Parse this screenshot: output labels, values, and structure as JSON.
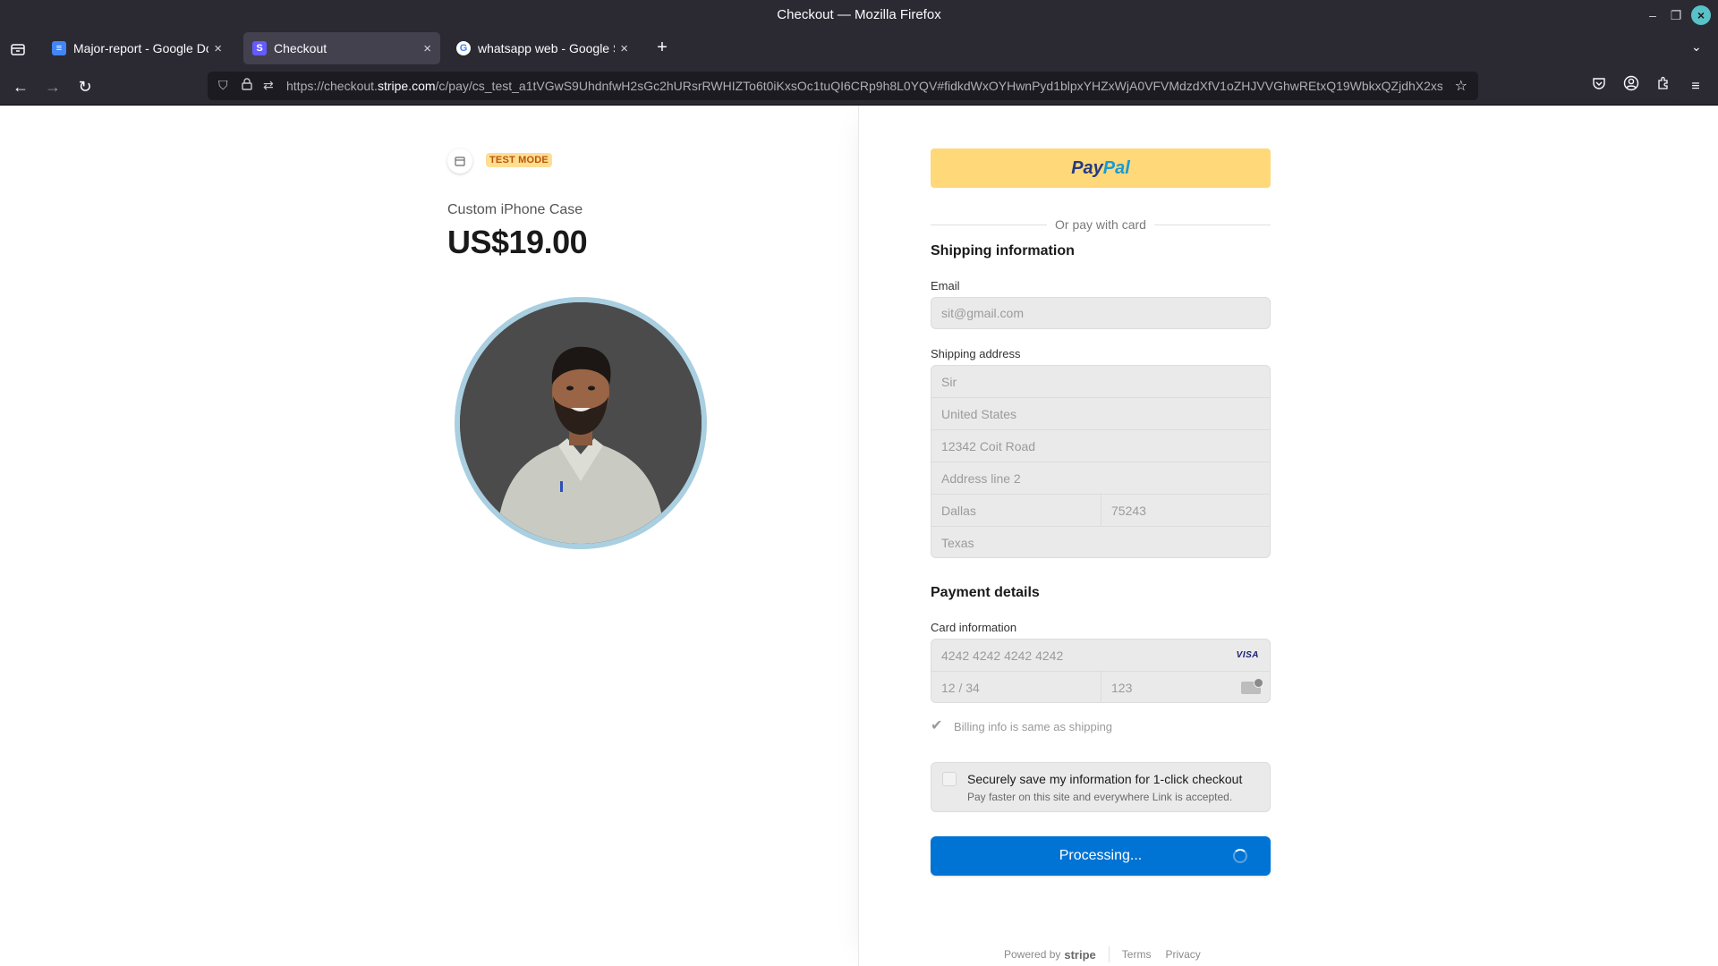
{
  "window": {
    "title": "Checkout — Mozilla Firefox"
  },
  "tabs": [
    {
      "label": "Major-report - Google Docs",
      "favicon": "google-docs-icon",
      "active": false
    },
    {
      "label": "Checkout",
      "favicon": "stripe-icon",
      "active": true
    },
    {
      "label": "whatsapp web - Google Sea",
      "favicon": "google-icon",
      "active": false
    }
  ],
  "urlbar": {
    "prefix": "https://checkout.",
    "domain": "stripe.com",
    "path": "/c/pay/cs_test_a1tVGwS9UhdnfwH2sGc2hURsrRWHIZTo6t0iKxsOc1tuQI6CRp9h8L0YQV#fidkdWxOYHwnPyd1blpxYHZxWjA0VFVMdzdXfV1oZHJVVGhwREtxQ19WbkxQZjdhX2xs"
  },
  "product": {
    "test_mode_label": "TEST MODE",
    "name": "Custom iPhone Case",
    "price": "US$19.00"
  },
  "checkout": {
    "paypal_part1": "Pay",
    "paypal_part2": "Pal",
    "or_text": "Or pay with card",
    "shipping_title": "Shipping information",
    "email_label": "Email",
    "email_value": "sit@gmail.com",
    "shipping_label": "Shipping address",
    "address": {
      "name": "Sir",
      "country": "United States",
      "line1": "12342 Coit Road",
      "line2_placeholder": "Address line 2",
      "city": "Dallas",
      "zip": "75243",
      "state": "Texas"
    },
    "payment_title": "Payment details",
    "card_label": "Card information",
    "card_number": "4242 4242 4242 4242",
    "card_brand": "VISA",
    "expiry": "12 / 34",
    "cvc": "123",
    "billing_same": "Billing info is same as shipping",
    "link_title": "Securely save my information for 1-click checkout",
    "link_subtitle": "Pay faster on this site and everywhere Link is accepted.",
    "pay_button": "Processing..."
  },
  "footer": {
    "powered_by": "Powered by",
    "brand": "stripe",
    "terms": "Terms",
    "privacy": "Privacy"
  },
  "colors": {
    "pay_button": "#0074d4",
    "paypal_button": "#ffd87a",
    "test_badge_bg": "#ffde92",
    "test_badge_text": "#bb5504",
    "browser_chrome": "#2b2a33"
  }
}
